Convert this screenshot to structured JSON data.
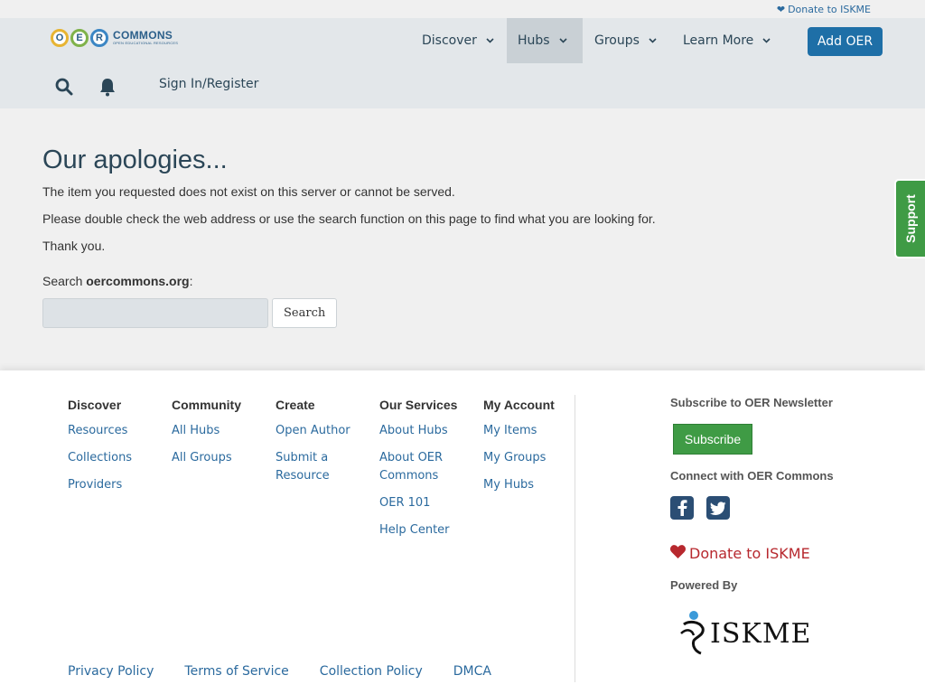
{
  "top": {
    "donate_label": "Donate to ISKME"
  },
  "logo": {
    "letters": [
      "O",
      "E",
      "R"
    ],
    "word": "COMMONS",
    "tagline": "OPEN EDUCATIONAL RESOURCES"
  },
  "nav": {
    "items": [
      {
        "label": "Discover",
        "icon": "chevron-down-icon"
      },
      {
        "label": "Hubs",
        "icon": "chevron-down-icon",
        "active": true
      },
      {
        "label": "Groups",
        "icon": "chevron-down-icon"
      },
      {
        "label": "Learn More",
        "icon": "chevron-down-icon"
      }
    ],
    "add_oer": "Add OER",
    "search_icon": "search-icon",
    "bell_icon": "bell-icon",
    "signin": "Sign In/Register"
  },
  "main": {
    "title": "Our apologies...",
    "paragraphs": [
      "The item you requested does not exist on this server or cannot be served.",
      "Please double check the web address or use the search function on this page to find what you are looking for.",
      "Thank you."
    ],
    "search_prefix": "Search ",
    "search_site": "oercommons.org",
    "search_suffix": ":",
    "search_value": "",
    "search_button": "Search"
  },
  "support_tab": "Support",
  "footer": {
    "columns": [
      {
        "title": "Discover",
        "links": [
          "Resources",
          "Collections",
          "Providers"
        ]
      },
      {
        "title": "Community",
        "links": [
          "All Hubs",
          "All Groups"
        ]
      },
      {
        "title": "Create",
        "links": [
          "Open Author",
          "Submit a Resource"
        ]
      },
      {
        "title": "Our Services",
        "links": [
          "About Hubs",
          "About OER Commons",
          "OER 101",
          "Help Center"
        ]
      },
      {
        "title": "My Account",
        "links": [
          "My Items",
          "My Groups",
          "My Hubs"
        ]
      }
    ],
    "newsletter_title": "Subscribe to OER Newsletter",
    "subscribe_button": "Subscribe",
    "connect_title": "Connect with OER Commons",
    "social": [
      "facebook-icon",
      "twitter-icon"
    ],
    "donate_label": "Donate to ISKME",
    "powered_by": "Powered By",
    "iskme_wordmark": "ISKME",
    "bottom_links": [
      "Privacy Policy",
      "Terms of Service",
      "Collection Policy",
      "DMCA"
    ]
  },
  "colors": {
    "link": "#2b6a9e",
    "header_bg": "#e3e7ea",
    "primary_button": "#1e6fa7",
    "green": "#3f9b45",
    "donate_red": "#b7282e"
  }
}
